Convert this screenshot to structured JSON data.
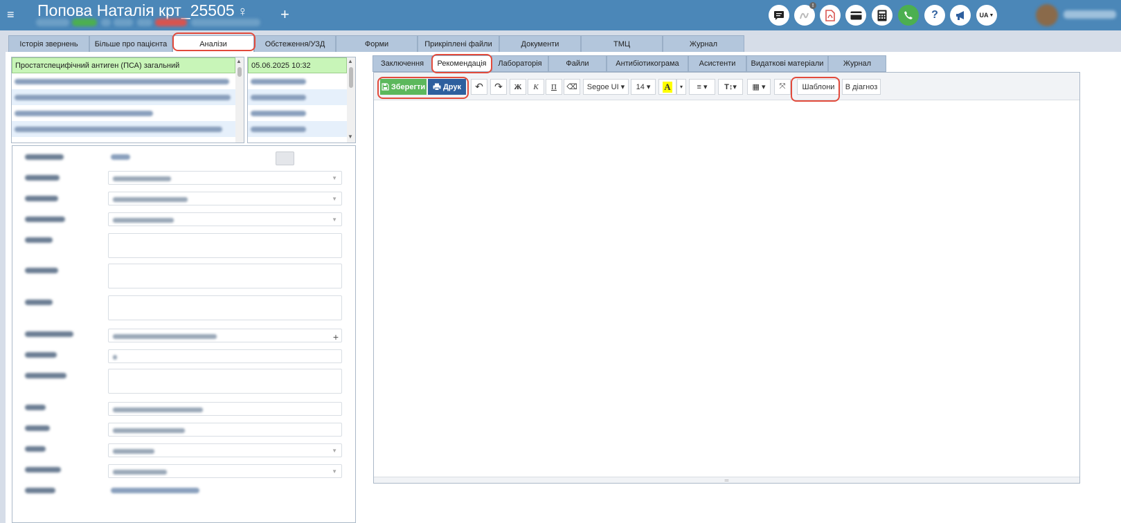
{
  "header": {
    "patient_name": "Попова Наталія крт_25505",
    "gender_symbol": "♀",
    "menu_symbol": "≡",
    "add_symbol": "+",
    "icons": [
      "chat-icon",
      "signature-icon",
      "pdf-icon",
      "card-icon",
      "calculator-icon",
      "phone-icon",
      "help-icon",
      "announcement-icon",
      "language-selector"
    ],
    "language": "UA",
    "colors": {
      "bar": "#4b87b8",
      "phone": "#4caf50"
    }
  },
  "main_tabs": [
    {
      "label": "Історія звернень"
    },
    {
      "label": "Більше про пацієнта"
    },
    {
      "label": "Аналізи",
      "active": true
    },
    {
      "label": "Обстеження/УЗД"
    },
    {
      "label": "Форми"
    },
    {
      "label": "Прикріплені файли"
    },
    {
      "label": "Документи"
    },
    {
      "label": "ТМЦ"
    },
    {
      "label": "Журнал"
    }
  ],
  "analyses_list": {
    "selected_name": "Простатспецифічний антиген (ПСА) загальний",
    "selected_date": "05.06.2025 10:32"
  },
  "right_tabs": [
    {
      "label": "Заключення"
    },
    {
      "label": "Рекомендація",
      "active": true
    },
    {
      "label": "Лабораторія"
    },
    {
      "label": "Файли"
    },
    {
      "label": "Антибіотикограма"
    },
    {
      "label": "Асистенти"
    },
    {
      "label": "Видаткові матеріали"
    },
    {
      "label": "Журнал"
    }
  ],
  "toolbar": {
    "save_label": "Зберегти",
    "print_label": "Друк",
    "undo": "↶",
    "redo": "↷",
    "bold": "Ж",
    "italic": "К",
    "underline": "П",
    "eraser": "⌫",
    "font_family": "Segoe UI ▾",
    "font_size": "14 ▾",
    "highlight": "A",
    "highlight_caret": "▾",
    "align": "≡ ▾",
    "text_style": "T↕▾",
    "table": "▦ ▾",
    "fullscreen": "⤧",
    "templates_label": "Шаблони",
    "to_diagnosis_label": "В діагноз",
    "highlight_color": "#ffff00"
  },
  "accent": {
    "highlight_ring": "#e24a3b",
    "save_green": "#5cb85c",
    "print_blue": "#2e5f9e"
  }
}
